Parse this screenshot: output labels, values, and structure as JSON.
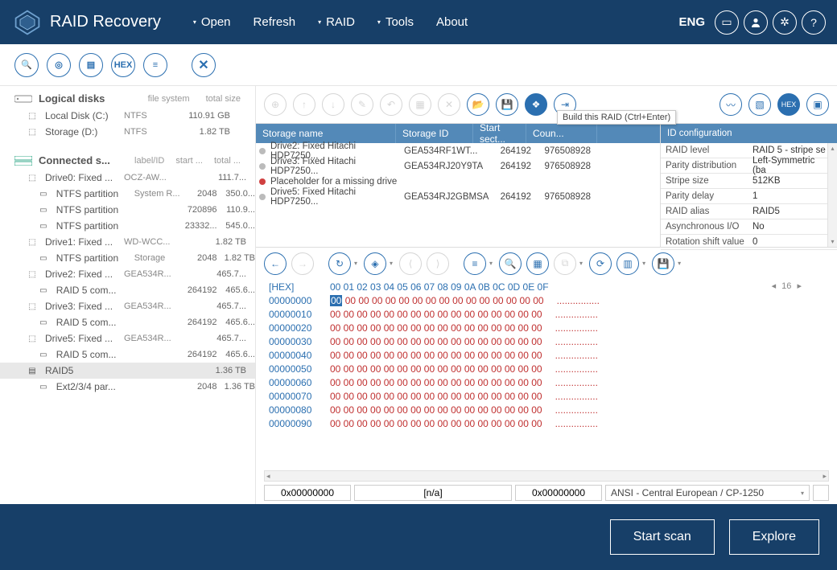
{
  "app_title": "RAID Recovery",
  "menu": {
    "open": "Open",
    "refresh": "Refresh",
    "raid": "RAID",
    "tools": "Tools",
    "about": "About"
  },
  "lang": "ENG",
  "tooltip_build_raid": "Build this RAID (Ctrl+Enter)",
  "left": {
    "logical_title": "Logical disks",
    "logical_cols": {
      "fs": "file system",
      "size": "total size"
    },
    "logical": [
      {
        "name": "Local Disk (C:)",
        "fs": "NTFS",
        "size": "110.91 GB"
      },
      {
        "name": "Storage (D:)",
        "fs": "NTFS",
        "size": "1.82 TB"
      }
    ],
    "connected_title": "Connected s...",
    "connected_cols": {
      "label": "label/ID",
      "start": "start ...",
      "total": "total ..."
    },
    "rows": [
      {
        "depth": 0,
        "name": "Drive0: Fixed ...",
        "c1": "OCZ-AW...",
        "c2": "",
        "c3": "111.7..."
      },
      {
        "depth": 1,
        "name": "NTFS partition",
        "c1": "System R...",
        "c2": "2048",
        "c3": "350.0..."
      },
      {
        "depth": 1,
        "name": "NTFS partition",
        "c1": "",
        "c2": "720896",
        "c3": "110.9..."
      },
      {
        "depth": 1,
        "name": "NTFS partition",
        "c1": "",
        "c2": "23332...",
        "c3": "545.0..."
      },
      {
        "depth": 0,
        "name": "Drive1: Fixed ...",
        "c1": "WD-WCC...",
        "c2": "",
        "c3": "1.82 TB"
      },
      {
        "depth": 1,
        "name": "NTFS partition",
        "c1": "Storage",
        "c2": "2048",
        "c3": "1.82 TB"
      },
      {
        "depth": 0,
        "name": "Drive2: Fixed ...",
        "c1": "GEA534R...",
        "c2": "",
        "c3": "465.7..."
      },
      {
        "depth": 1,
        "name": "RAID 5 com...",
        "c1": "",
        "c2": "264192",
        "c3": "465.6..."
      },
      {
        "depth": 0,
        "name": "Drive3: Fixed ...",
        "c1": "GEA534R...",
        "c2": "",
        "c3": "465.7..."
      },
      {
        "depth": 1,
        "name": "RAID 5 com...",
        "c1": "",
        "c2": "264192",
        "c3": "465.6..."
      },
      {
        "depth": 0,
        "name": "Drive5: Fixed ...",
        "c1": "GEA534R...",
        "c2": "",
        "c3": "465.7..."
      },
      {
        "depth": 1,
        "name": "RAID 5 com...",
        "c1": "",
        "c2": "264192",
        "c3": "465.6..."
      },
      {
        "depth": 0,
        "name": "RAID5",
        "c1": "",
        "c2": "",
        "c3": "1.36 TB",
        "selected": true,
        "icon": "raid"
      },
      {
        "depth": 1,
        "name": "Ext2/3/4 par...",
        "c1": "",
        "c2": "2048",
        "c3": "1.36 TB"
      }
    ]
  },
  "storage": {
    "headers": {
      "name": "Storage name",
      "id": "Storage ID",
      "start": "Start sect...",
      "count": "Coun..."
    },
    "rows": [
      {
        "name": "Drive2: Fixed Hitachi HDP7250...",
        "id": "GEA534RF1WT...",
        "start": "264192",
        "count": "976508928"
      },
      {
        "name": "Drive3: Fixed Hitachi HDP7250...",
        "id": "GEA534RJ20Y9TA",
        "start": "264192",
        "count": "976508928"
      },
      {
        "name": "Placeholder for a missing drive",
        "id": "",
        "start": "",
        "count": "",
        "missing": true
      },
      {
        "name": "Drive5: Fixed Hitachi HDP7250...",
        "id": "GEA534RJ2GBMSA",
        "start": "264192",
        "count": "976508928"
      }
    ]
  },
  "config": {
    "title": "ID configuration",
    "rows": [
      {
        "k": "RAID level",
        "v": "RAID 5 - stripe se",
        "dd": true
      },
      {
        "k": "Parity distribution",
        "v": "Left-Symmetric (ba",
        "dd": true
      },
      {
        "k": "Stripe size",
        "v": "512KB",
        "dd": true
      },
      {
        "k": "Parity delay",
        "v": "1"
      },
      {
        "k": "RAID alias",
        "v": "RAID5"
      },
      {
        "k": "Asynchronous I/O",
        "v": "No",
        "dd": true
      },
      {
        "k": "Rotation shift value",
        "v": "0"
      }
    ]
  },
  "hex": {
    "label": "[HEX]",
    "cols": "00 01 02 03 04 05 06 07 08 09 0A 0B 0C 0D 0E 0F",
    "page": "16",
    "offsets": [
      "00000000",
      "00000010",
      "00000020",
      "00000030",
      "00000040",
      "00000050",
      "00000060",
      "00000070",
      "00000080",
      "00000090"
    ],
    "zero_row": "00 00 00 00 00 00 00 00 00 00 00 00 00 00 00 00",
    "ascii_row": "................",
    "bottom": {
      "off1": "0x00000000",
      "na": "[n/a]",
      "off2": "0x00000000",
      "encoding": "ANSI - Central European / CP-1250"
    }
  },
  "footer": {
    "start": "Start scan",
    "explore": "Explore"
  }
}
